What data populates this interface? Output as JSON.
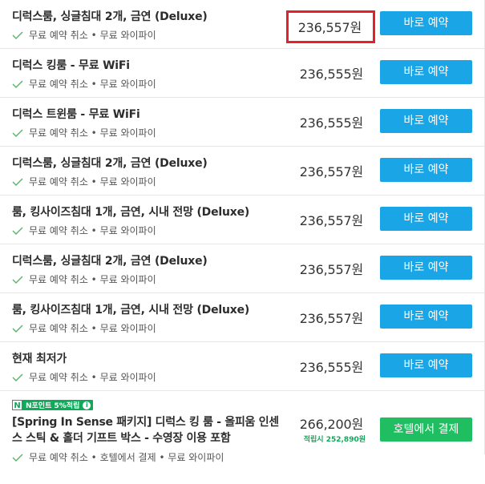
{
  "features_icon": "check-icon",
  "colors": {
    "primary": "#1aa6e6",
    "green": "#1fbf61",
    "highlight": "#e3202c"
  },
  "rows": [
    {
      "room": "디럭스룸, 싱글침대 2개, 금연 (Deluxe)",
      "features": "무료 예약 취소 • 무료 와이파이",
      "price": "236,557원",
      "button": "바로 예약"
    },
    {
      "room": "디럭스 킹룸 - 무료 WiFi",
      "features": "무료 예약 취소 • 무료 와이파이",
      "price": "236,555원",
      "button": "바로 예약"
    },
    {
      "room": "디럭스 트윈룸 - 무료 WiFi",
      "features": "무료 예약 취소 • 무료 와이파이",
      "price": "236,555원",
      "button": "바로 예약"
    },
    {
      "room": "디럭스룸, 싱글침대 2개, 금연 (Deluxe)",
      "features": "무료 예약 취소 • 무료 와이파이",
      "price": "236,557원",
      "button": "바로 예약"
    },
    {
      "room": "룸, 킹사이즈침대 1개, 금연, 시내 전망 (Deluxe)",
      "features": "무료 예약 취소 • 무료 와이파이",
      "price": "236,557원",
      "button": "바로 예약"
    },
    {
      "room": "디럭스룸, 싱글침대 2개, 금연 (Deluxe)",
      "features": "무료 예약 취소 • 무료 와이파이",
      "price": "236,557원",
      "button": "바로 예약"
    },
    {
      "room": "룸, 킹사이즈침대 1개, 금연, 시내 전망 (Deluxe)",
      "features": "무료 예약 취소 • 무료 와이파이",
      "price": "236,557원",
      "button": "바로 예약"
    },
    {
      "room": "현재 최저가",
      "features": "무료 예약 취소 • 무료 와이파이",
      "price": "236,555원",
      "button": "바로 예약"
    }
  ],
  "package": {
    "badge_letter": "N",
    "badge_text": "N포인트 5%적립",
    "badge_info": "i",
    "title": "[Spring In Sense 패키지] 디럭스 킹 룸 - 올피움 인센스 스틱 & 홀더 기프트 박스 - 수영장 이용 포함",
    "features": "무료 예약 취소 • 호텔에서 결제 • 무료 와이파이",
    "price": "266,200원",
    "earn_text": "적립시 252,890원",
    "button": "호텔에서 결제"
  }
}
